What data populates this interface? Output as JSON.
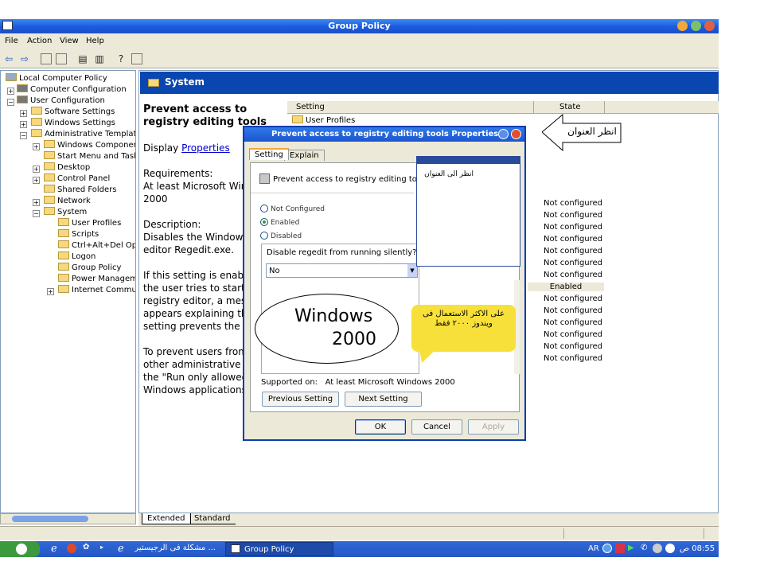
{
  "window": {
    "title": "Group Policy"
  },
  "menu": [
    "File",
    "Action",
    "View",
    "Help"
  ],
  "tree": {
    "root": "Local Computer Policy",
    "computer": "Computer Configuration",
    "user": "User Configuration",
    "items": [
      "Software Settings",
      "Windows Settings",
      "Administrative Templates",
      "Windows Components",
      "Start Menu and Taskba",
      "Desktop",
      "Control Panel",
      "Shared Folders",
      "Network",
      "System",
      "User Profiles",
      "Scripts",
      "Ctrl+Alt+Del Optio",
      "Logon",
      "Group Policy",
      "Power Managemen",
      "Internet Communic"
    ]
  },
  "pane": {
    "header": "System",
    "setting_title": "Prevent access to registry editing tools",
    "display": "Display",
    "properties_link": "Properties",
    "req_label": "Requirements:",
    "req_text": "At least Microsoft Win",
    "req_text2": "2000",
    "desc_label": "Description:",
    "desc_1": "Disables the Windows",
    "desc_2": "editor Regedit.exe.",
    "p3": [
      "If this setting is enable",
      "the user tries to start",
      "registry editor, a mes",
      "appears explaining tha",
      "setting prevents the a"
    ],
    "p4": [
      "To prevent users from",
      "other administrative to",
      "the \"Run only allowed",
      "Windows applications\""
    ]
  },
  "list": {
    "col_setting": "Setting",
    "col_state": "State",
    "first_row": "User Profiles",
    "states": [
      "Not configured",
      "Not configured",
      "Not configured",
      "Not configured",
      "Not configured",
      "Not configured",
      "Not configured",
      "Enabled",
      "Not configured",
      "Not configured",
      "Not configured",
      "Not configured",
      "Not configured",
      "Not configured"
    ]
  },
  "tabs": {
    "extended": "Extended",
    "standard": "Standard"
  },
  "dialog": {
    "title": "Prevent access to registry editing tools Properties",
    "tab_setting": "Setting",
    "tab_explain": "Explain",
    "policy_name": "Prevent access to registry editing tools",
    "opt_not_configured": "Not Configured",
    "opt_enabled": "Enabled",
    "opt_disabled": "Disabled",
    "option_label": "Disable regedit from running silently?",
    "option_value": "No",
    "supported_label": "Supported on:",
    "supported_value": "At least Microsoft Windows 2000",
    "prev": "Previous Setting",
    "next": "Next Setting",
    "ok": "OK",
    "cancel": "Cancel",
    "apply": "Apply"
  },
  "annotations": {
    "arrow_text": "انظر العنوان",
    "popup_text": "انظر الى العنوان",
    "ellipse_line1": "Windows",
    "ellipse_line2": "2000",
    "callout_line1": "على الاكثر الاستعمال فى",
    "callout_line2": "ويندوز ٢٠٠٠ فقط"
  },
  "taskbar": {
    "item1": "... مشكلة فى الرجيستير",
    "item2": "Group Policy",
    "lang": "AR",
    "clock": "08:55 ص"
  },
  "colors": {
    "titlebar": "#1c5ce0",
    "header": "#0a46b0",
    "callout": "#f7e03a"
  }
}
